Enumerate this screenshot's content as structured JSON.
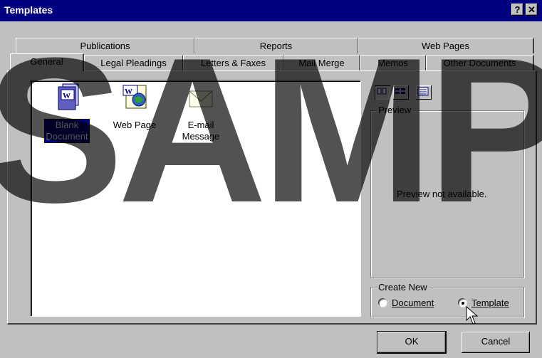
{
  "window": {
    "title": "Templates",
    "help_label": "?",
    "close_label": "✕"
  },
  "tabs_back": [
    "Publications",
    "Reports",
    "Web Pages"
  ],
  "tabs_front": [
    "General",
    "Legal Pleadings",
    "Letters & Faxes",
    "Mail Merge",
    "Memos",
    "Other Documents"
  ],
  "active_tab": "General",
  "items": [
    {
      "label1": "Blank",
      "label2": "Document",
      "icon": "word-document-icon",
      "selected": true
    },
    {
      "label1": "Web Page",
      "label2": "",
      "icon": "web-page-icon",
      "selected": false
    },
    {
      "label1": "E-mail",
      "label2": "Message",
      "icon": "email-envelope-icon",
      "selected": false
    }
  ],
  "view_buttons": [
    "large-icons-view-icon",
    "list-view-icon",
    "details-view-icon"
  ],
  "preview": {
    "title": "Preview",
    "message": "Preview not available."
  },
  "create_new": {
    "title": "Create New",
    "option_document": "Document",
    "option_template": "Template",
    "selected": "Template"
  },
  "buttons": {
    "ok": "OK",
    "cancel": "Cancel"
  },
  "watermark": "SAMP",
  "colors": {
    "titlebar": "#000080",
    "face": "#c0c0c0",
    "selection": "#000080"
  }
}
